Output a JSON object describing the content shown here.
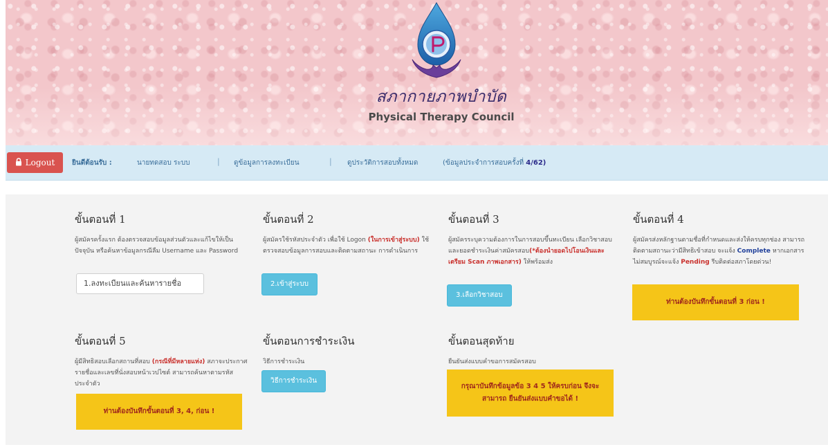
{
  "header": {
    "brand_thai": "สภากายภาพบำบัด",
    "brand_en": "Physical Therapy Council"
  },
  "nav": {
    "logout_label": "Logout",
    "welcome": "ยินดีต้อนรับ :",
    "user_name": "นายทดสอบ ระบบ",
    "link_registration": "ดูข้อมูลการลงทะเบียน",
    "link_history": "ดูประวัติการสอบทั้งหมด",
    "round_prefix": "(ข้อมูลประจำการสอบครั้งที่",
    "round_value": "4/62)"
  },
  "steps": {
    "s1": {
      "title": "ขั้นตอนที่ 1",
      "desc": "ผู้สมัครครั้งแรก ต้องตรวจสอบข้อมูลส่วนตัวและแก้ไขให้เป็นปัจจุบัน หรือค้นหาข้อมูลกรณีลืม Username และ Password",
      "button": "1.ลงทะเบียนและค้นหารายชื่อ"
    },
    "s2": {
      "title": "ขั้นตอนที่ 2",
      "desc_a": "ผู้สมัครใช้รหัสประจำตัว เพื่อใช้ Logon",
      "desc_red": "(ในการเข้าสู่ระบบ)",
      "desc_b": "ใช้ตรวจสอบข้อมูลการสอบและติดตามสถานะ การดำเนินการ",
      "button": "2.เข้าสู่ระบบ"
    },
    "s3": {
      "title": "ขั้นตอนที่ 3",
      "desc_a": "ผู้สมัครระบุความต้องการในการสอบขึ้นทะเบียน เลือกวิชาสอบ และยอดชำระเงินค่าสมัครสอบ",
      "desc_red": "(*ต้องนำยอดไปโอนเงินและเตรียม Scan ภาพเอกสาร)",
      "desc_b": "ให้พร้อมส่ง",
      "button": "3.เลือกวิชาสอบ"
    },
    "s4": {
      "title": "ขั้นตอนที่ 4",
      "desc_a": "ผู้สมัครส่งหลักฐานตามชื่อที่กำหนดและส่งให้ครบทุกช่อง สามารถติดตามสถานะว่ามีสิทธิเข้าสอบ จะแจ้ง",
      "desc_blue1": "Complete",
      "desc_b": "หากเอกสารไม่สมบูรณ์จะแจ้ง",
      "desc_red": "Pending",
      "desc_c": "รีบติดต่อสภาโดยด่วน!",
      "warning": "ท่านต้องบันทึกขั้นตอนที่ 3 ก่อน !"
    },
    "s5": {
      "title": "ขั้นตอนที่ 5",
      "desc_a": "ผู้มีสิทธิสอบเลือกสถานที่สอบ",
      "desc_red": "(กรณีที่มีหลายแห่ง)",
      "desc_b": "สภาจะประกาศ รายชื่อและเลขที่นั่งสอบหน้าเวปไซต์ สามารถค้นหาตามรหัสประจำตัว",
      "warning": "ท่านต้องบันทึกขั้นตอนที่ 3, 4, ก่อน !"
    },
    "payment": {
      "title": "ขั้นตอนการชำระเงิน",
      "desc": "วิธีการชำระเงิน",
      "button": "วิธีการชำระเงิน"
    },
    "final": {
      "title": "ขั้นตอนสุดท้าย",
      "desc": "ยืนยันส่งแบบคำขอการสมัครสอบ",
      "warning": "กรุณาบันทึกข้อมูลข้อ 3 4 5 ให้ครบก่อน จึงจะสามารถ ยืนยันส่งแบบคำขอได้ !"
    }
  },
  "colors": {
    "logout_bg": "#d9534f",
    "nav_bg": "#d6eaf5",
    "info_button": "#5bc0de",
    "warning_bg": "#f5c518",
    "banner_bg": "#f3c7cb"
  },
  "icons": {
    "logout": "lock-icon",
    "logo": "water-drop-hands-logo"
  }
}
